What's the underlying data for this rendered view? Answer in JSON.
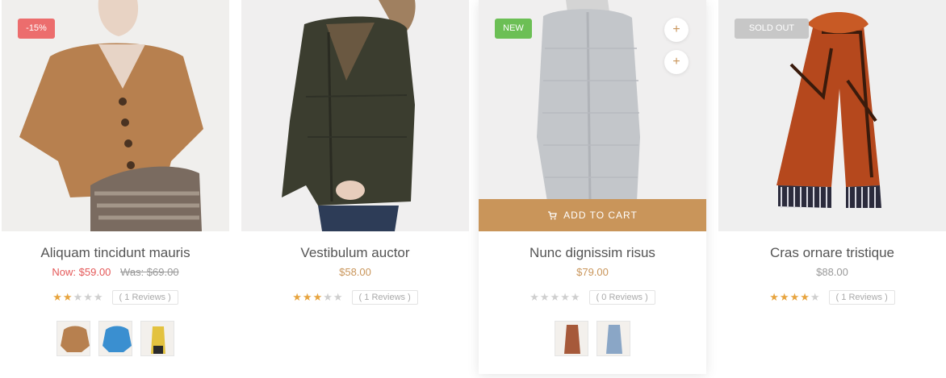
{
  "products": [
    {
      "badge": "-15%",
      "title": "Aliquam tincidunt mauris",
      "price_new": "Now: $59.00",
      "price_old": "Was: $69.00",
      "rating": 2,
      "reviews": "( 1 Reviews )",
      "swatches": [
        "brown-sweater-swatch",
        "blue-sweater-swatch",
        "yellow-sweater-swatch"
      ]
    },
    {
      "badge": "",
      "title": "Vestibulum auctor",
      "price": "$58.00",
      "rating": 3,
      "reviews": "( 1 Reviews )",
      "swatches": []
    },
    {
      "badge": "New",
      "title": "Nunc dignissim risus",
      "price": "$79.00",
      "rating": 0,
      "reviews": "( 0 Reviews )",
      "cart_label": "Add to cart",
      "action_icons": [
        "plus-icon",
        "plus-icon"
      ],
      "swatches": [
        "rust-coat-swatch",
        "blue-coat-swatch"
      ]
    },
    {
      "badge": "Sold out",
      "title": "Cras ornare tristique",
      "price": "$88.00",
      "rating": 4,
      "reviews": "( 1 Reviews )",
      "swatches": []
    }
  ],
  "colors": {
    "accent": "#c9955a",
    "sale_badge": "#ec6d6d",
    "new_badge": "#6cbf55",
    "sold_badge": "#c7c7c7",
    "star": "#e7a43f"
  }
}
